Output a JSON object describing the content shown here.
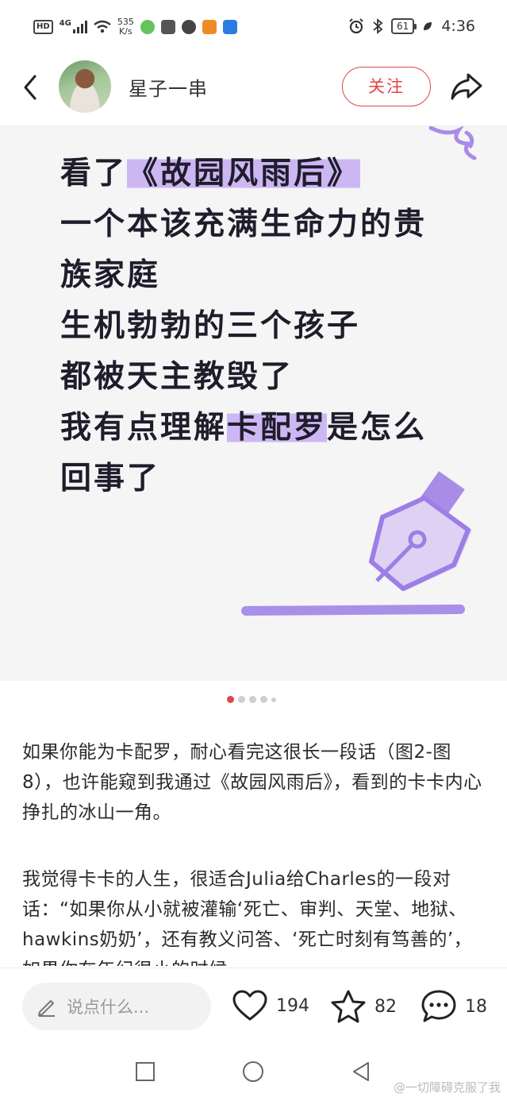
{
  "status_bar": {
    "network_label": "HD",
    "network_gen": "4G",
    "speed_value": "535",
    "speed_unit": "K/s",
    "battery": "61",
    "time": "4:36"
  },
  "header": {
    "username": "星子一串",
    "follow_label": "关注"
  },
  "image_card": {
    "lines": [
      {
        "pre": "看了",
        "highlight": "《故园风雨后》",
        "post": ""
      },
      {
        "pre": "一个本该充满生命力的贵",
        "highlight": "",
        "post": ""
      },
      {
        "pre": "族家庭",
        "highlight": "",
        "post": ""
      },
      {
        "pre": "生机勃勃的三个孩子",
        "highlight": "",
        "post": ""
      },
      {
        "pre": "都被天主教毁了",
        "highlight": "",
        "post": ""
      },
      {
        "pre": "我有点理解",
        "highlight": "卡配罗",
        "post": "是怎么"
      },
      {
        "pre": "回事了",
        "highlight": "",
        "post": ""
      }
    ],
    "accent_color": "#a98be8"
  },
  "carousel": {
    "count": 5,
    "active": 0
  },
  "post_text": {
    "para1": "如果你能为卡配罗，耐心看完这很长一段话（图2-图8），也许能窥到我通过《故园风雨后》，看到的卡卡内心挣扎的冰山一角。",
    "para2": "我觉得卡卡的人生，很适合Julia给Charles的一段对话：“如果你从小就被灌输‘死亡、审判、天堂、地狱、hawkins奶奶’，还有教义问答、‘死亡时刻有笃善的’，如果你在年纪很小的时候"
  },
  "bottom_bar": {
    "comment_placeholder": "说点什么...",
    "likes": "194",
    "favorites": "82",
    "comments": "18"
  },
  "watermark": "@一切障碍克服了我",
  "colors": {
    "brand_red": "#e0454a",
    "highlight": "#cdb7f3"
  }
}
